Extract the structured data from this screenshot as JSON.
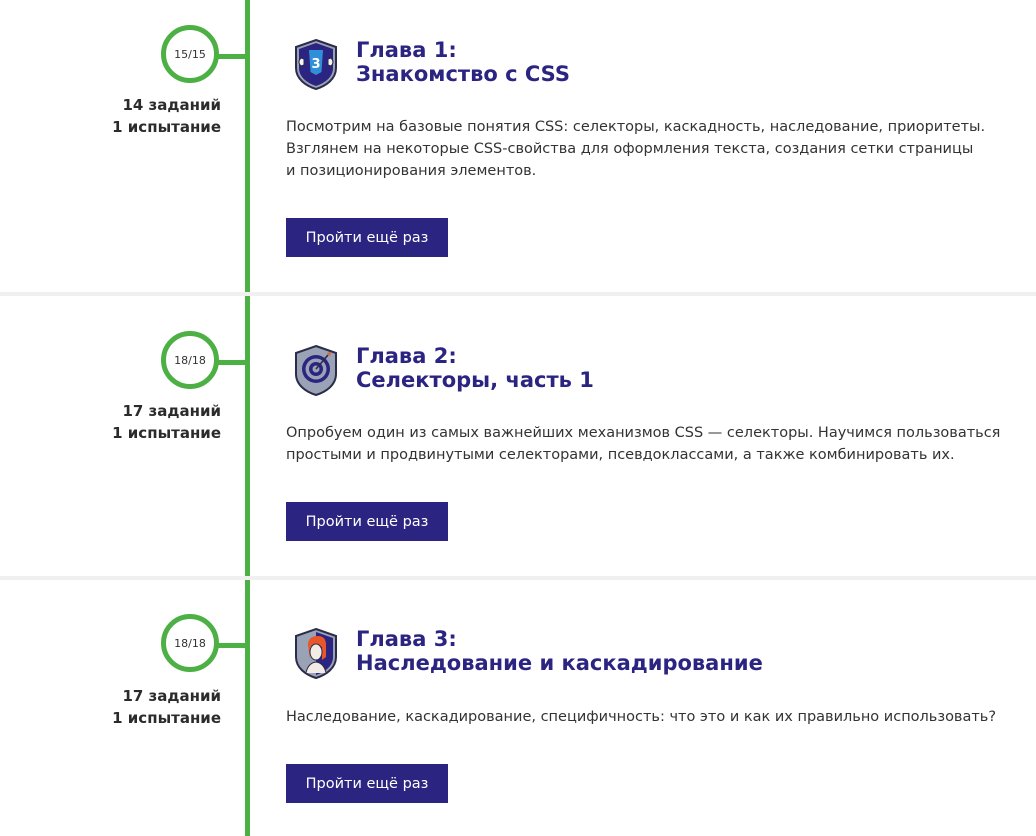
{
  "colors": {
    "accent_green": "#4cb044",
    "brand_purple": "#2b2480",
    "text": "#333333"
  },
  "chapters": [
    {
      "progress": "15/15",
      "tasks": "14 заданий",
      "trials": "1 испытание",
      "badge_icon": "css3-shield-icon",
      "title_line1": "Глава 1:",
      "title_line2": "Знакомство с CSS",
      "description_line1": "Посмотрим на базовые понятия CSS: селекторы, каскадность, наследование, приоритеты.",
      "description_line2": "Взглянем на некоторые CSS-свойства для оформления текста, создания сетки страницы",
      "description_line3": "и позиционирования элементов.",
      "button_label": "Пройти ещё раз"
    },
    {
      "progress": "18/18",
      "tasks": "17 заданий",
      "trials": "1 испытание",
      "badge_icon": "target-shield-icon",
      "title_line1": "Глава 2:",
      "title_line2": "Селекторы, часть 1",
      "description_line1": "Опробуем один из самых важнейших механизмов CSS — селекторы. Научимся пользоваться",
      "description_line2": "простыми и продвинутыми селекторами, псевдоклассами, а также комбинировать их.",
      "button_label": "Пройти ещё раз"
    },
    {
      "progress": "18/18",
      "tasks": "17 заданий",
      "trials": "1 испытание",
      "badge_icon": "portrait-shield-icon",
      "title_line1": "Глава 3:",
      "title_line2": "Наследование и каскадирование",
      "description_line1": "Наследование, каскадирование, специфичность: что это и как их правильно использовать?",
      "button_label": "Пройти ещё раз"
    }
  ]
}
